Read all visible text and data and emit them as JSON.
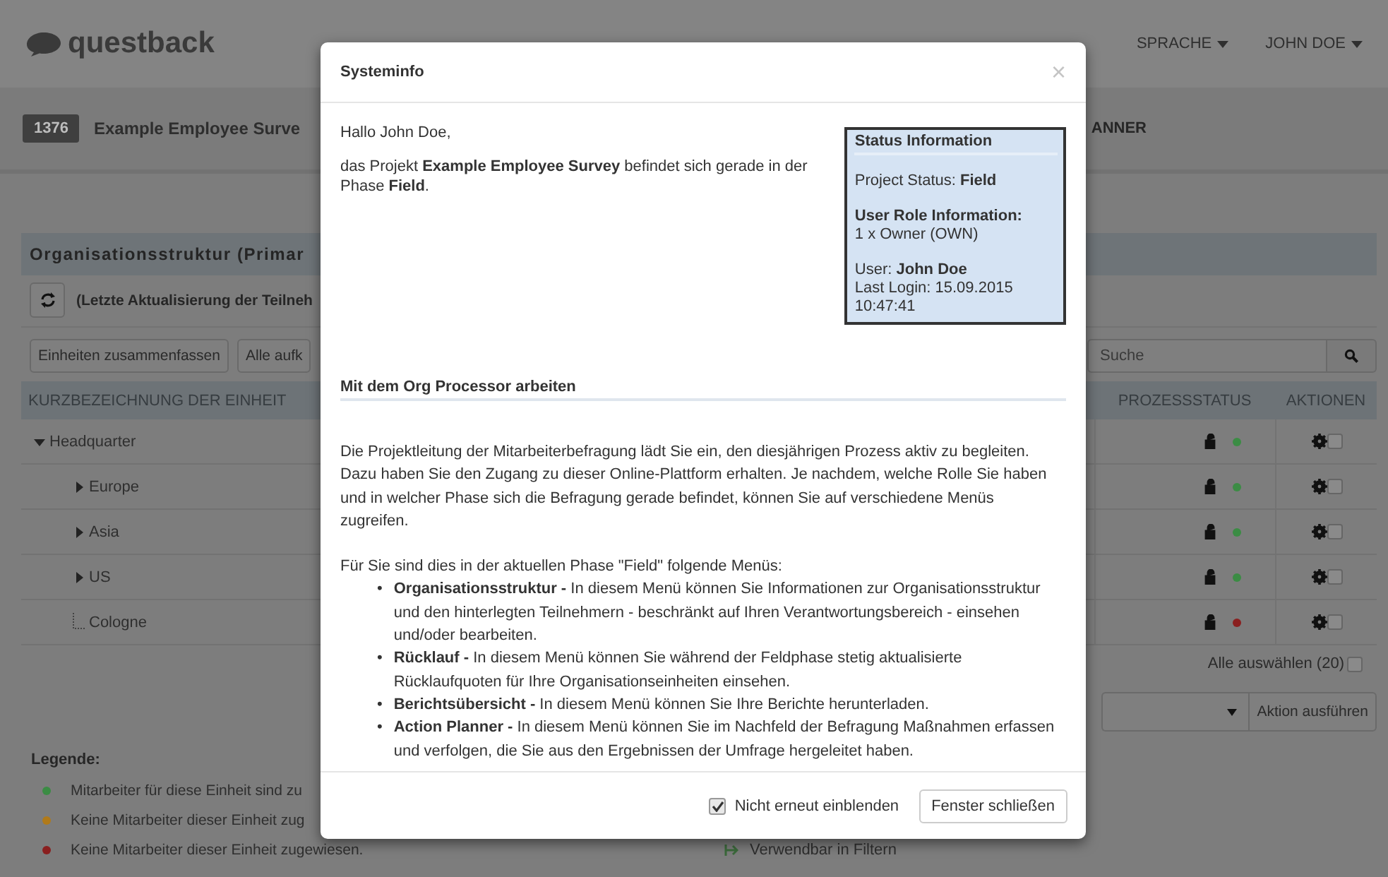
{
  "topbar": {
    "logo": "questback",
    "nav": [
      {
        "label": "SPRACHE"
      },
      {
        "label": "JOHN DOE"
      }
    ]
  },
  "project": {
    "id": "1376",
    "title": "Example Employee Surve",
    "tab": "ANNER"
  },
  "section": {
    "title": "Organisationsstruktur (Primar",
    "update_text": "(Letzte Aktualisierung der Teilneh"
  },
  "toolbar": {
    "buttons": [
      "Einheiten zusammenfassen",
      "Alle aufk"
    ],
    "search": {
      "placeholder": "Suche"
    }
  },
  "table": {
    "columns": [
      "KURZBEZEICHNUNG DER EINHEIT",
      "PROZESSSTATUS",
      "AKTIONEN"
    ],
    "rows": [
      {
        "name": "Headquarter",
        "expanded": true,
        "color": "#3b8c44",
        "checked": false,
        "children": [
          {
            "name": "Europe",
            "expanded": false,
            "color": "#3b8c44",
            "checked": false
          },
          {
            "name": "Asia",
            "expanded": false,
            "color": "#3b8c44",
            "checked": false
          },
          {
            "name": "US",
            "expanded": false,
            "color": "#3b8c44",
            "checked": false
          },
          {
            "name": "Cologne",
            "color": "#8a1f1f",
            "checked": false
          }
        ]
      }
    ]
  },
  "select_all": {
    "label": "Alle auswählen (20)",
    "checked": false
  },
  "action": {
    "button": "Aktion ausführen"
  },
  "legend": {
    "title": "Legende:",
    "items": [
      {
        "text": "Mitarbeiter für diese Einheit sind zu",
        "color": "#3b8c44"
      },
      {
        "text": "Keine Mitarbeiter dieser Einheit zug",
        "color": "#b07a1a"
      },
      {
        "text": "Keine Mitarbeiter dieser Einheit zugewiesen.",
        "color": "#8a1f1f"
      }
    ],
    "filter_items": [
      {
        "text": "Verwendbar in Filtern"
      }
    ]
  },
  "modal": {
    "title": "Systeminfo",
    "greeting": "Hallo John Doe,",
    "intro": "das Projekt **Example Employee Survey** befindet sich gerade in der Phase **Field**.",
    "status_box": {
      "title": "Status Information",
      "lines": [
        "Project Status: **Field**",
        "**User Role Information:**",
        "1 x Owner (OWN)",
        "User: **John Doe**",
        "Last Login: 15.09.2015 10:47:41"
      ]
    },
    "heading": "Mit dem Org Processor arbeiten",
    "paragraph": "Die Projektleitung der Mitarbeiterbefragung lädt Sie ein, den diesjährigen Prozess aktiv zu begleiten. Dazu haben Sie den Zugang zu dieser Online-Plattform erhalten. Je nachdem, welche Rolle Sie haben und in welcher Phase sich die Befragung gerade befindet, können Sie auf verschiedene Menüs zugreifen.",
    "list_intro": "Für Sie sind dies in der aktuellen Phase \"Field\" folgende Menüs:",
    "list": [
      "**Organisationsstruktur -** In diesem Menü können Sie Informationen zur Organisationsstruktur und den hinterlegten Teilnehmern - beschränkt auf Ihren Verantwortungsbereich - einsehen und/oder bearbeiten.",
      "**Rücklauf -** In diesem Menü können Sie während der Feldphase stetig aktualisierte Rücklaufquoten für Ihre Organisationseinheiten einsehen.",
      "**Berichtsübersicht -** In diesem Menü können Sie Ihre Berichte herunterladen.",
      "**Action Planner -** In diesem Menü können Sie im Nachfeld der Befragung Maßnahmen erfassen und verfolgen, die Sie aus den Ergebnissen der Umfrage hergeleitet haben."
    ],
    "dont_show": {
      "label": "Nicht erneut einblenden",
      "checked": true
    },
    "close_button": "Fenster schließen",
    "close_icon": "×",
    "bullet": "•"
  }
}
